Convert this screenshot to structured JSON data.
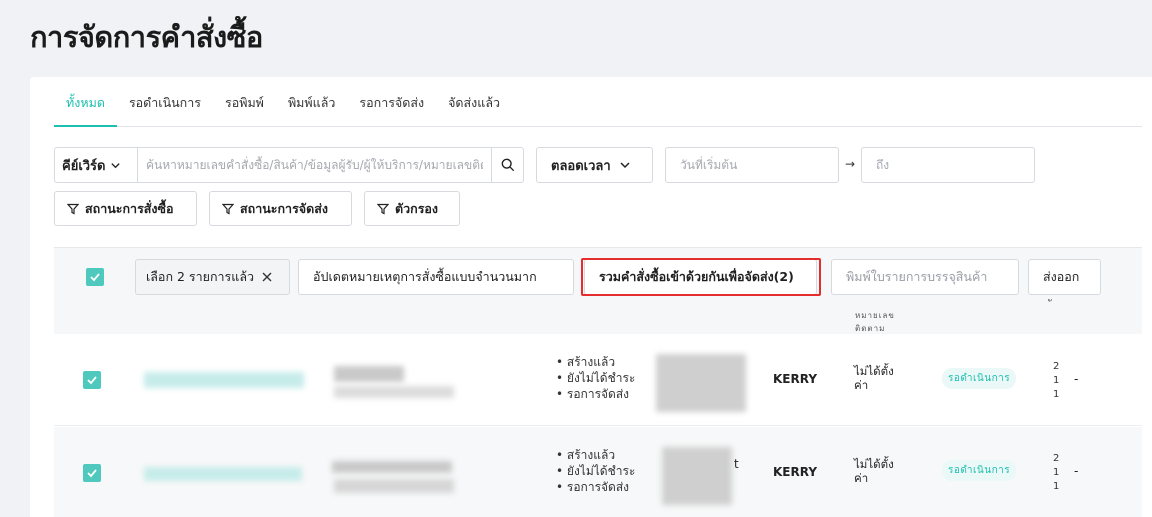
{
  "page": {
    "title": "การจัดการคำสั่งซื้อ"
  },
  "tabs": [
    {
      "label": "ทั้งหมด",
      "active": true
    },
    {
      "label": "รอดำเนินการ"
    },
    {
      "label": "รอพิมพ์"
    },
    {
      "label": "พิมพ์แล้ว"
    },
    {
      "label": "รอการจัดส่ง"
    },
    {
      "label": "จัดส่งแล้ว"
    }
  ],
  "search": {
    "keyword_select": "คีย์เวิร์ด",
    "placeholder": "ค้นหาหมายเลขคำสั่งซื้อ/สินค้า/ข้อมูลผู้รับ/ผู้ให้บริการ/หมายเลขติดตาม",
    "value": ""
  },
  "time_filter": {
    "label": "ตลอดเวลา"
  },
  "date_range": {
    "start_placeholder": "วันที่เริ่มต้น",
    "arrow": "→",
    "end_placeholder": "ถึง"
  },
  "filters": {
    "order_status": "สถานะการสั่งซื้อ",
    "shipping_status": "สถานะการจัดส่ง",
    "filter": "ตัวกรอง"
  },
  "bulk_actions": {
    "selected_label": "เลือก 2 รายการแล้ว",
    "clear_icon": "close-icon",
    "update_notes": "อัปเดตหมายเหตุการสั่งซื้อแบบจำนวนมาก",
    "merge_orders": "รวมคำสั่งซื้อเข้าด้วยกันเพื่อจัดส่ง(2)",
    "print_packing": "พิมพ์ใบรายการบรรจุสินค้า",
    "export": "ส่งออก"
  },
  "table_header": {
    "tracking_col": "หมายเลข\nติดตาม",
    "extra_col": "ั"
  },
  "rows": [
    {
      "statuses": [
        "สร้างแล้ว",
        "ยังไม่ได้ชำระ",
        "รอการจัดส่ง"
      ],
      "carrier": "KERRY",
      "tracking": "ไม่ได้ตั้ง\nค่า",
      "badge": "รอดำเนินการ",
      "counts": [
        "2",
        "1",
        "1"
      ],
      "dash": "-"
    },
    {
      "statuses": [
        "สร้างแล้ว",
        "ยังไม่ได้ชำระ",
        "รอการจัดส่ง"
      ],
      "carrier": "KERRY",
      "tracking": "ไม่ได้ตั้ง\nค่า",
      "badge": "รอดำเนินการ",
      "counts": [
        "2",
        "1",
        "1"
      ],
      "dash": "-",
      "partial_text": "t"
    }
  ],
  "colors": {
    "accent": "#1dbfae",
    "checkbox": "#4fc9bd",
    "highlight": "#e52d2d"
  }
}
